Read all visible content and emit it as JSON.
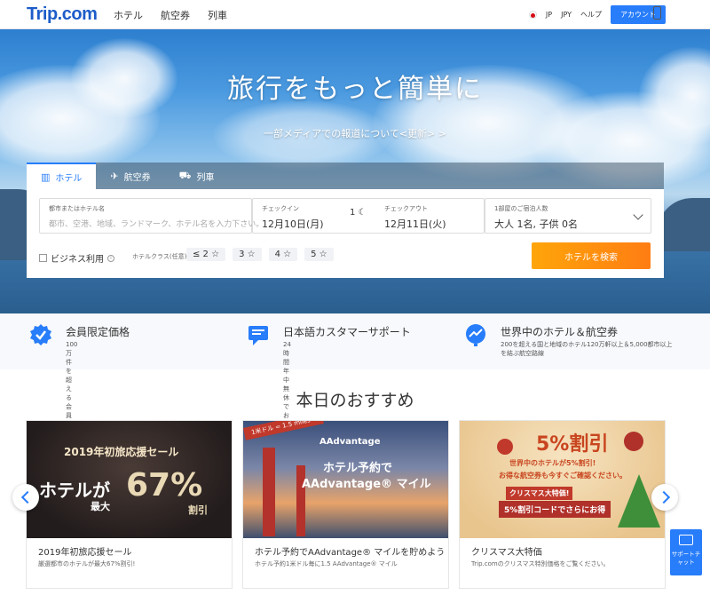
{
  "header": {
    "logo": "Trip.com",
    "nav": [
      "ホテル",
      "航空券",
      "列車"
    ],
    "lang": "JP",
    "currency": "JPY",
    "help": "ヘルプ",
    "account": "アカウント"
  },
  "hero": {
    "title": "旅行をもっと簡単に",
    "link": "一部メディアでの報道について<更新> >"
  },
  "search": {
    "tabs": [
      {
        "label": "ホテル",
        "icon": "hotel-icon"
      },
      {
        "label": "航空券",
        "icon": "plane-icon"
      },
      {
        "label": "列車",
        "icon": "train-icon"
      }
    ],
    "destination_label": "都市またはホテル名",
    "destination_placeholder": "都市、空港、地域、ランドマーク、ホテル名を入力下さい。",
    "checkin_label": "チェックイン",
    "checkin_value": "12月10日(月)",
    "nights": "1",
    "checkout_label": "チェックアウト",
    "checkout_value": "12月11日(火)",
    "guests_label": "1部屋のご宿泊人数",
    "guests_value": "大人 1名, 子供 0名",
    "business": "ビジネス利用",
    "class_label": "ホテルクラス(任意)",
    "class_options": [
      "≤ 2 ☆",
      "3 ☆",
      "4 ☆",
      "5 ☆"
    ],
    "search_button": "ホテルを検索"
  },
  "features": [
    {
      "title": "会員限定価格",
      "sub": "100万件を超える会員様限定商品",
      "icon": "badge-check-icon"
    },
    {
      "title": "日本語カスタマーサポート",
      "sub": "24時間年中無休でお客様をサポート",
      "icon": "chat-support-icon"
    },
    {
      "title": "世界中のホテル＆航空券",
      "sub": "200を超える国と地域のホテル120万軒以上＆5,000都市以上を結ぶ航空路線",
      "icon": "globe-trend-icon"
    }
  ],
  "recommend": {
    "title": "本日のおすすめ",
    "cards": [
      {
        "title": "2019年初旅応援セール",
        "sub": "厳選都市のホテルが最大67%割引!",
        "img_line1": "2019年初旅応援セール",
        "img_line2": "ホテルが",
        "img_line3": "最大",
        "img_big": "67%",
        "img_line4": "割引"
      },
      {
        "title": "ホテル予約でAAdvantage® マイルを貯めよう",
        "sub": "ホテル予約1米ドル毎に1.5 AAdvantage® マイル",
        "img_ribbon": "1米ドル = 1.5 miles",
        "img_brand": "AAdvantage",
        "img_line1": "ホテル予約で",
        "img_line2": "AAdvantage® マイル"
      },
      {
        "title": "クリスマス大特価",
        "sub": "Trip.comのクリスマス特別価格をご覧ください。",
        "img_big": "5%割引",
        "img_line1": "世界中のホテルが5%割引!",
        "img_line2": "お得な航空券も今すぐご確認ください。",
        "img_line3": "クリスマス大特価!",
        "img_line4": "5%割引コードでさらにお得"
      }
    ]
  },
  "chat": {
    "label": "サポートチャット"
  },
  "colors": {
    "brand": "#287dfa",
    "logo": "#1d5cc9",
    "cta": "#ff8a10"
  }
}
